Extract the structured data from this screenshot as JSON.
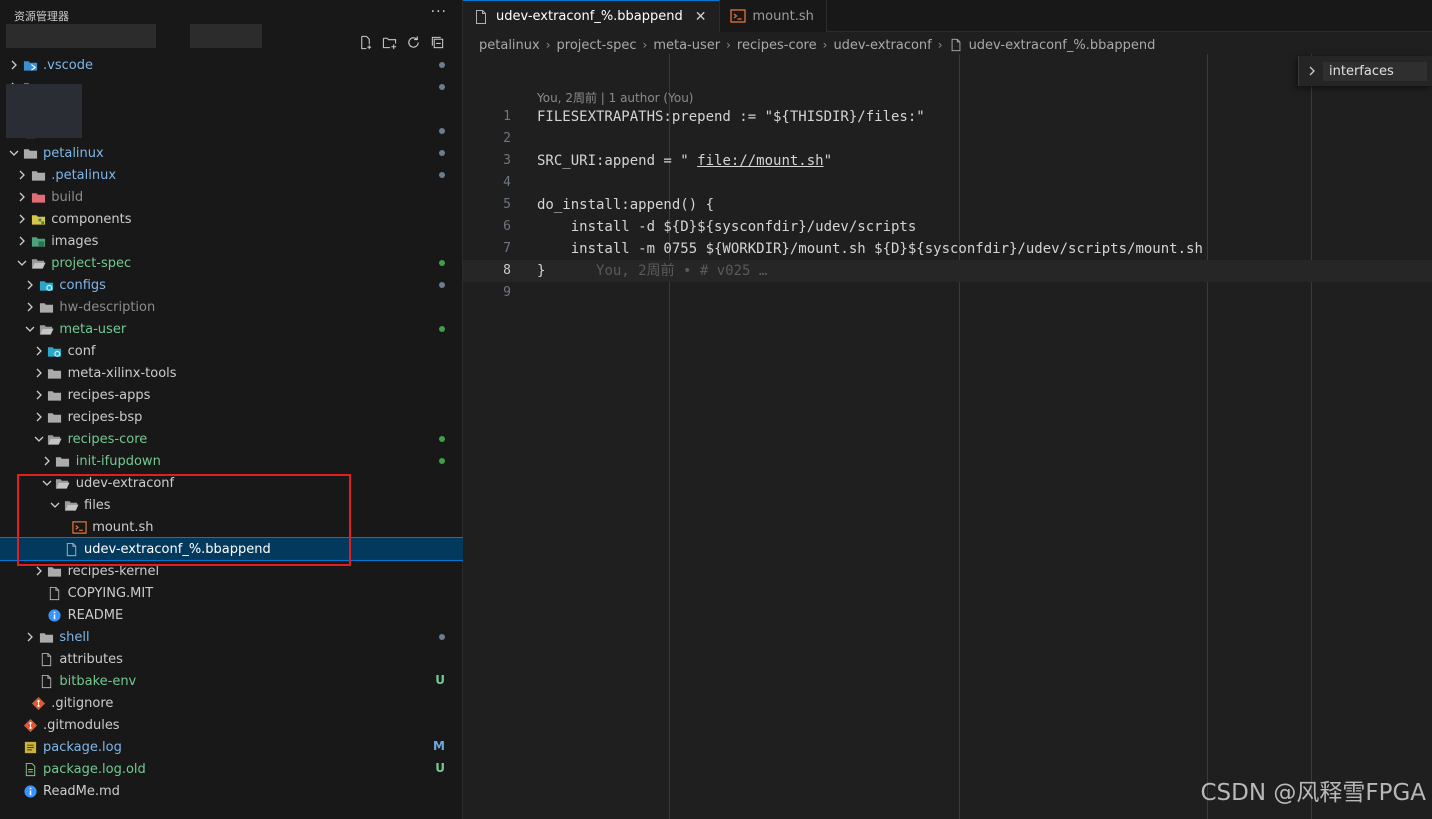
{
  "explorer": {
    "title": "资源管理器",
    "more": "···",
    "toolbar": [
      "new-file-icon",
      "new-folder-icon",
      "refresh-icon",
      "collapse-all-icon"
    ],
    "rows": [
      {
        "label": ".vscode",
        "depth": 0,
        "kind": "folder-vscode",
        "collapsed": true,
        "color": "#7fb6e8",
        "dot": "#6a7d91"
      },
      {
        "label": "",
        "depth": 0,
        "kind": "folder-red",
        "collapsed": true,
        "color": "#cccccc",
        "dot": "#6a7d91"
      },
      {
        "label": "",
        "depth": 0,
        "kind": "hidden",
        "collapsed": true,
        "color": "#cccccc",
        "dot": ""
      },
      {
        "label": "",
        "depth": 0,
        "kind": "hidden",
        "collapsed": true,
        "color": "#cccccc",
        "dot": "#6a7d91"
      },
      {
        "label": "petalinux",
        "depth": 0,
        "kind": "folder",
        "collapsed": false,
        "color": "#7fb6e8",
        "dot": "#6a7d91"
      },
      {
        "label": ".petalinux",
        "depth": 1,
        "kind": "folder",
        "collapsed": true,
        "color": "#7fb6e8",
        "dot": "#6a7d91"
      },
      {
        "label": "build",
        "depth": 1,
        "kind": "folder-red",
        "collapsed": true,
        "color": "#8c8c8c",
        "dot": ""
      },
      {
        "label": "components",
        "depth": 1,
        "kind": "folder-yellow",
        "collapsed": true,
        "color": "#cccccc",
        "dot": ""
      },
      {
        "label": "images",
        "depth": 1,
        "kind": "folder-green",
        "collapsed": true,
        "color": "#cccccc",
        "dot": ""
      },
      {
        "label": "project-spec",
        "depth": 1,
        "kind": "folder-open",
        "collapsed": false,
        "color": "#73c991",
        "dot": "#3ea047"
      },
      {
        "label": "configs",
        "depth": 2,
        "kind": "folder-config",
        "collapsed": true,
        "color": "#7fb6e8",
        "dot": "#6a7d91"
      },
      {
        "label": "hw-description",
        "depth": 2,
        "kind": "folder",
        "collapsed": true,
        "color": "#8c8c8c",
        "dot": ""
      },
      {
        "label": "meta-user",
        "depth": 2,
        "kind": "folder-open",
        "collapsed": false,
        "color": "#73c991",
        "dot": "#3ea047"
      },
      {
        "label": "conf",
        "depth": 3,
        "kind": "folder-config",
        "collapsed": true,
        "color": "#cccccc",
        "dot": ""
      },
      {
        "label": "meta-xilinx-tools",
        "depth": 3,
        "kind": "folder",
        "collapsed": true,
        "color": "#cccccc",
        "dot": ""
      },
      {
        "label": "recipes-apps",
        "depth": 3,
        "kind": "folder",
        "collapsed": true,
        "color": "#cccccc",
        "dot": ""
      },
      {
        "label": "recipes-bsp",
        "depth": 3,
        "kind": "folder",
        "collapsed": true,
        "color": "#cccccc",
        "dot": ""
      },
      {
        "label": "recipes-core",
        "depth": 3,
        "kind": "folder-open",
        "collapsed": false,
        "color": "#73c991",
        "dot": "#3ea047"
      },
      {
        "label": "init-ifupdown",
        "depth": 4,
        "kind": "folder",
        "collapsed": true,
        "color": "#73c991",
        "dot": "#3ea047"
      },
      {
        "label": "udev-extraconf",
        "depth": 4,
        "kind": "folder-open",
        "collapsed": false,
        "color": "#cccccc",
        "dot": ""
      },
      {
        "label": "files",
        "depth": 5,
        "kind": "folder-open",
        "collapsed": false,
        "color": "#cccccc",
        "dot": ""
      },
      {
        "label": "mount.sh",
        "depth": 6,
        "kind": "shell",
        "collapsed": null,
        "color": "#cccccc",
        "dot": ""
      },
      {
        "label": "udev-extraconf_%.bbappend",
        "depth": 5,
        "kind": "file",
        "collapsed": null,
        "color": "#ffffff",
        "dot": "",
        "selected": true
      },
      {
        "label": "recipes-kernel",
        "depth": 3,
        "kind": "folder",
        "collapsed": true,
        "color": "#cccccc",
        "dot": ""
      },
      {
        "label": "COPYING.MIT",
        "depth": 3,
        "kind": "file",
        "collapsed": null,
        "color": "#cccccc",
        "dot": ""
      },
      {
        "label": "README",
        "depth": 3,
        "kind": "info",
        "collapsed": null,
        "color": "#cccccc",
        "dot": ""
      },
      {
        "label": "shell",
        "depth": 2,
        "kind": "folder",
        "collapsed": true,
        "color": "#7fb6e8",
        "dot": "#6a7d91"
      },
      {
        "label": "attributes",
        "depth": 2,
        "kind": "file",
        "collapsed": null,
        "color": "#cccccc",
        "dot": ""
      },
      {
        "label": "bitbake-env",
        "depth": 2,
        "kind": "file",
        "collapsed": null,
        "color": "#73c991",
        "decoration": "U",
        "decoration_color": "#73c991"
      },
      {
        "label": ".gitignore",
        "depth": 1,
        "kind": "git",
        "collapsed": null,
        "color": "#cccccc",
        "dot": ""
      },
      {
        "label": ".gitmodules",
        "depth": 0,
        "kind": "git",
        "collapsed": null,
        "color": "#cccccc",
        "dot": ""
      },
      {
        "label": "package.log",
        "depth": 0,
        "kind": "log",
        "collapsed": null,
        "color": "#7fb6e8",
        "decoration": "M",
        "decoration_color": "#6fa8dc"
      },
      {
        "label": "package.log.old",
        "depth": 0,
        "kind": "file-green",
        "collapsed": null,
        "color": "#73c991",
        "decoration": "U",
        "decoration_color": "#73c991"
      },
      {
        "label": "ReadMe.md",
        "depth": 0,
        "kind": "info",
        "collapsed": null,
        "color": "#cccccc",
        "dot": ""
      }
    ]
  },
  "tabs": [
    {
      "label": "udev-extraconf_%.bbappend",
      "active": true,
      "icon": "file-icon",
      "close": "✕"
    },
    {
      "label": "mount.sh",
      "active": false,
      "icon": "shell-icon",
      "close": ""
    }
  ],
  "breadcrumb": [
    "petalinux",
    "project-spec",
    "meta-user",
    "recipes-core",
    "udev-extraconf",
    "udev-extraconf_%.bbappend"
  ],
  "sticky_scroll": {
    "label": "interfaces"
  },
  "editor": {
    "blame_header": "You, 2周前 | 1 author (You)",
    "current_line": 8,
    "lines": [
      {
        "n": "1",
        "text": "FILESEXTRAPATHS:prepend := \"${THISDIR}/files:\""
      },
      {
        "n": "2",
        "text": ""
      },
      {
        "n": "3",
        "text": "SRC_URI:append = \" ",
        "link": "file://mount.sh",
        "after": "\""
      },
      {
        "n": "4",
        "text": ""
      },
      {
        "n": "5",
        "text": "do_install:append() {"
      },
      {
        "n": "6",
        "text": "    install -d ${D}${sysconfdir}/udev/scripts"
      },
      {
        "n": "7",
        "text": "    install -m 0755 ${WORKDIR}/mount.sh ${D}${sysconfdir}/udev/scripts/mount.sh"
      },
      {
        "n": "8",
        "text": "}",
        "inline_blame": "You, 2周前 • # v025 …"
      },
      {
        "n": "9",
        "text": ""
      }
    ]
  },
  "watermark": "CSDN @风释雪FPGA"
}
